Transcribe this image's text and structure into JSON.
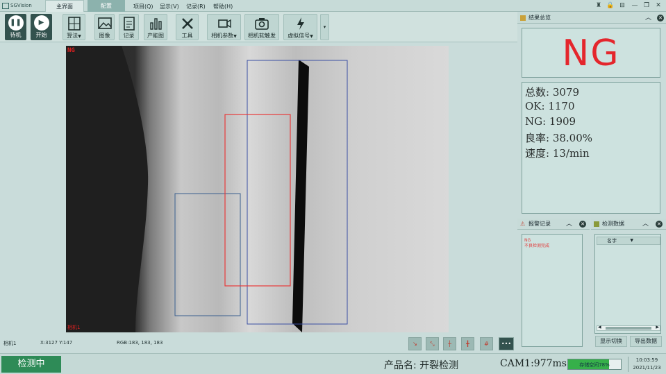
{
  "app": {
    "name": "SGVision"
  },
  "tabs": [
    "主界面",
    "配置"
  ],
  "menu": [
    "项目(Q)",
    "显示(V)",
    "记录(R)",
    "帮助(H)"
  ],
  "toolbar": {
    "standby": "待机",
    "start": "开始",
    "algorithm": "算法",
    "image": "图像",
    "record": "记录",
    "chart": "产能图",
    "tools": "工具",
    "camera_params": "相机参数",
    "soft_trigger": "相机软触发",
    "virtual_signal": "虚拟信号"
  },
  "image_view": {
    "result_tag": "NG",
    "camera_tag": "相机1",
    "status_camera": "相机1",
    "coords": "X:3127 Y:147",
    "rgb": "RGB:183, 183, 183"
  },
  "results_panel": {
    "title": "结果总览",
    "result": "NG",
    "stats": [
      "总数: 3079",
      "OK: 1170",
      "NG: 1909",
      "良率: 38.00%",
      "速度:  13/min"
    ]
  },
  "alarm_panel": {
    "title": "报警记录",
    "lines": [
      "NG",
      "不良检测完成"
    ]
  },
  "data_panel": {
    "title": "检测数据",
    "column": "名字",
    "toggle_button": "显示切换",
    "export_button": "导出数据"
  },
  "bottom": {
    "status_button": "检测中",
    "product": "产品名: 开裂检测",
    "cam_time": "CAM1:977ms",
    "storage_text": "存储空间78%",
    "storage_pct": 78,
    "time": "10:03:59",
    "date": "2021/11/23"
  },
  "colors": {
    "ng_red": "#e4262c",
    "accent_dark": "#33524e",
    "ok_green": "#2e8b57"
  }
}
